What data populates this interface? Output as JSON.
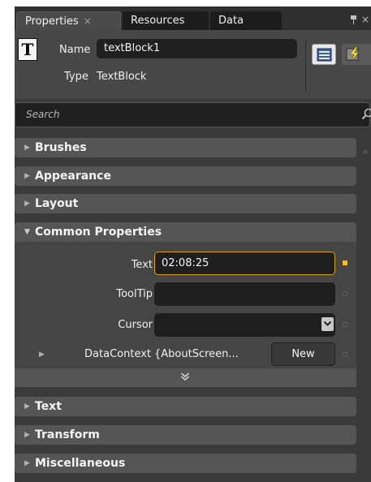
{
  "tabs": [
    {
      "label": "Properties",
      "close": "×",
      "active": true
    },
    {
      "label": "Resources",
      "active": false
    },
    {
      "label": "Data",
      "active": false
    }
  ],
  "pane_buttons": {
    "pin": "pin-icon",
    "close": "×"
  },
  "header": {
    "name_label": "Name",
    "name_value": "textBlock1",
    "type_label": "Type",
    "type_value": "TextBlock",
    "type_icon_glyph": "T"
  },
  "search": {
    "placeholder": "Search"
  },
  "categories_top": [
    "Brushes",
    "Appearance",
    "Layout"
  ],
  "common_properties": {
    "title": "Common Properties",
    "text_label": "Text",
    "text_value": "02:08:25",
    "tooltip_label": "ToolTip",
    "tooltip_value": "",
    "cursor_label": "Cursor",
    "cursor_value": "",
    "datacontext_label": "DataContext",
    "datacontext_value": "{AboutScreen...",
    "new_button": "New"
  },
  "categories_bottom": [
    "Text",
    "Transform",
    "Miscellaneous"
  ],
  "colors": {
    "panel": "#3a3a3a",
    "category": "#555555",
    "focus_border": "#d6a40a",
    "value_marker": "#f2c200"
  }
}
